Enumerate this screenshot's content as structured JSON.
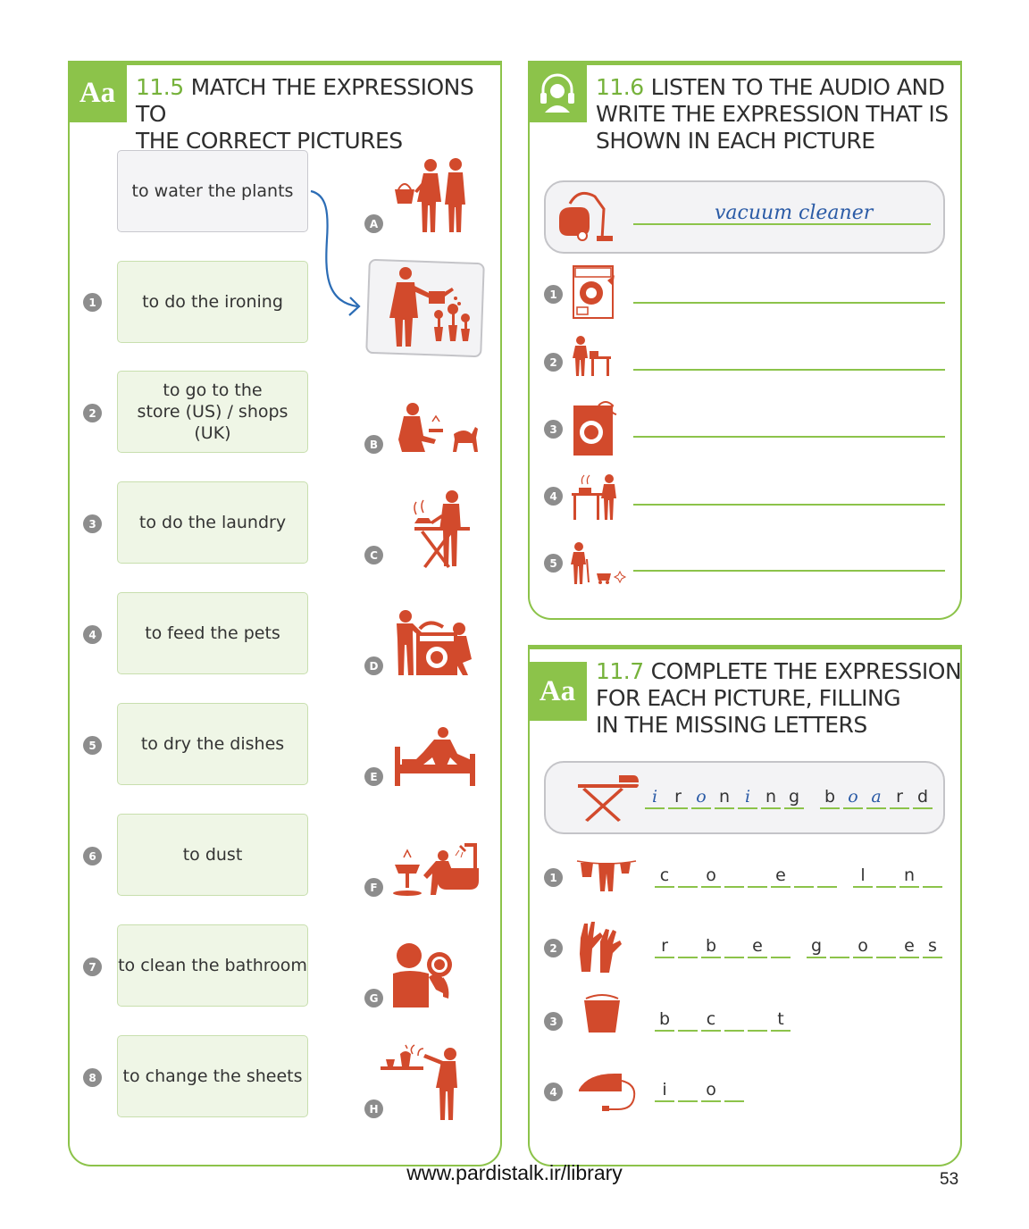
{
  "ex115": {
    "badge": "Aa",
    "number": "11.5",
    "title_line1": "MATCH THE EXPRESSIONS TO",
    "title_line2": "THE CORRECT PICTURES",
    "example_expression": "to water the plants",
    "expressions": [
      {
        "n": "1",
        "text": "to do the ironing"
      },
      {
        "n": "2",
        "line1": "to go to the",
        "line2": "store (US) / shops (UK)"
      },
      {
        "n": "3",
        "text": "to do the laundry"
      },
      {
        "n": "4",
        "text": "to feed the pets"
      },
      {
        "n": "5",
        "text": "to dry the dishes"
      },
      {
        "n": "6",
        "text": "to dust"
      },
      {
        "n": "7",
        "text": "to clean the bathroom"
      },
      {
        "n": "8",
        "text": "to change the sheets"
      }
    ],
    "picture_letters": [
      "A",
      "B",
      "C",
      "D",
      "E",
      "F",
      "G",
      "H"
    ]
  },
  "ex116": {
    "number": "11.6",
    "title_line1": "LISTEN TO THE AUDIO AND",
    "title_line2": "WRITE THE EXPRESSION THAT IS",
    "title_line3": "SHOWN IN EACH PICTURE",
    "headphones_icon": "headphones-icon",
    "example_answer": "vacuum cleaner",
    "numbers": [
      "1",
      "2",
      "3",
      "4",
      "5"
    ]
  },
  "ex117": {
    "badge": "Aa",
    "number": "11.7",
    "title_line1": "COMPLETE THE EXPRESSION",
    "title_line2": "FOR EACH PICTURE, FILLING",
    "title_line3": "IN THE MISSING LETTERS",
    "example_letters": [
      "i",
      "r",
      "o",
      "n",
      "i",
      "n",
      "g",
      " ",
      "b",
      "o",
      "a",
      "r",
      "d"
    ],
    "example_handwritten": [
      true,
      false,
      true,
      false,
      true,
      false,
      false,
      false,
      false,
      true,
      true,
      false,
      false
    ],
    "items": [
      {
        "n": "1",
        "letters": [
          "c",
          "",
          "o",
          "",
          "",
          "e",
          "",
          "",
          " ",
          "l",
          "",
          "n",
          ""
        ]
      },
      {
        "n": "2",
        "letters": [
          "r",
          "",
          "b",
          "",
          "e",
          "",
          " ",
          "g",
          "",
          "o",
          "",
          "e",
          "s"
        ]
      },
      {
        "n": "3",
        "letters": [
          "b",
          "",
          "c",
          "",
          "",
          "t"
        ]
      },
      {
        "n": "4",
        "letters": [
          "i",
          "",
          "o",
          ""
        ]
      }
    ]
  },
  "colors": {
    "accent": "#8cc34a",
    "icon_red": "#d24a2c",
    "handwriting": "#2b5ba6"
  },
  "footer": "www.pardistalk.ir/library",
  "page_number": "53"
}
